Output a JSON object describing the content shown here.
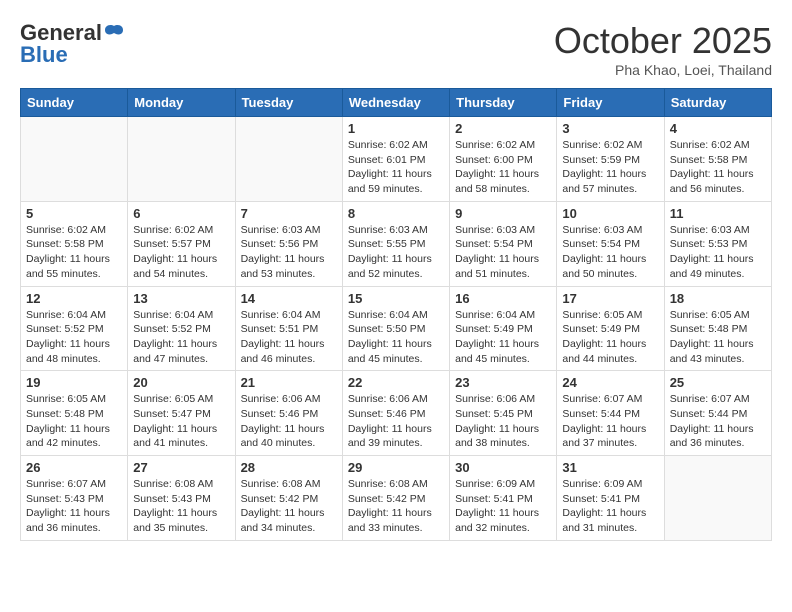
{
  "header": {
    "logo_general": "General",
    "logo_blue": "Blue",
    "month_title": "October 2025",
    "subtitle": "Pha Khao, Loei, Thailand"
  },
  "days_of_week": [
    "Sunday",
    "Monday",
    "Tuesday",
    "Wednesday",
    "Thursday",
    "Friday",
    "Saturday"
  ],
  "weeks": [
    [
      {
        "day": "",
        "info": ""
      },
      {
        "day": "",
        "info": ""
      },
      {
        "day": "",
        "info": ""
      },
      {
        "day": "1",
        "info": "Sunrise: 6:02 AM\nSunset: 6:01 PM\nDaylight: 11 hours\nand 59 minutes."
      },
      {
        "day": "2",
        "info": "Sunrise: 6:02 AM\nSunset: 6:00 PM\nDaylight: 11 hours\nand 58 minutes."
      },
      {
        "day": "3",
        "info": "Sunrise: 6:02 AM\nSunset: 5:59 PM\nDaylight: 11 hours\nand 57 minutes."
      },
      {
        "day": "4",
        "info": "Sunrise: 6:02 AM\nSunset: 5:58 PM\nDaylight: 11 hours\nand 56 minutes."
      }
    ],
    [
      {
        "day": "5",
        "info": "Sunrise: 6:02 AM\nSunset: 5:58 PM\nDaylight: 11 hours\nand 55 minutes."
      },
      {
        "day": "6",
        "info": "Sunrise: 6:02 AM\nSunset: 5:57 PM\nDaylight: 11 hours\nand 54 minutes."
      },
      {
        "day": "7",
        "info": "Sunrise: 6:03 AM\nSunset: 5:56 PM\nDaylight: 11 hours\nand 53 minutes."
      },
      {
        "day": "8",
        "info": "Sunrise: 6:03 AM\nSunset: 5:55 PM\nDaylight: 11 hours\nand 52 minutes."
      },
      {
        "day": "9",
        "info": "Sunrise: 6:03 AM\nSunset: 5:54 PM\nDaylight: 11 hours\nand 51 minutes."
      },
      {
        "day": "10",
        "info": "Sunrise: 6:03 AM\nSunset: 5:54 PM\nDaylight: 11 hours\nand 50 minutes."
      },
      {
        "day": "11",
        "info": "Sunrise: 6:03 AM\nSunset: 5:53 PM\nDaylight: 11 hours\nand 49 minutes."
      }
    ],
    [
      {
        "day": "12",
        "info": "Sunrise: 6:04 AM\nSunset: 5:52 PM\nDaylight: 11 hours\nand 48 minutes."
      },
      {
        "day": "13",
        "info": "Sunrise: 6:04 AM\nSunset: 5:52 PM\nDaylight: 11 hours\nand 47 minutes."
      },
      {
        "day": "14",
        "info": "Sunrise: 6:04 AM\nSunset: 5:51 PM\nDaylight: 11 hours\nand 46 minutes."
      },
      {
        "day": "15",
        "info": "Sunrise: 6:04 AM\nSunset: 5:50 PM\nDaylight: 11 hours\nand 45 minutes."
      },
      {
        "day": "16",
        "info": "Sunrise: 6:04 AM\nSunset: 5:49 PM\nDaylight: 11 hours\nand 45 minutes."
      },
      {
        "day": "17",
        "info": "Sunrise: 6:05 AM\nSunset: 5:49 PM\nDaylight: 11 hours\nand 44 minutes."
      },
      {
        "day": "18",
        "info": "Sunrise: 6:05 AM\nSunset: 5:48 PM\nDaylight: 11 hours\nand 43 minutes."
      }
    ],
    [
      {
        "day": "19",
        "info": "Sunrise: 6:05 AM\nSunset: 5:48 PM\nDaylight: 11 hours\nand 42 minutes."
      },
      {
        "day": "20",
        "info": "Sunrise: 6:05 AM\nSunset: 5:47 PM\nDaylight: 11 hours\nand 41 minutes."
      },
      {
        "day": "21",
        "info": "Sunrise: 6:06 AM\nSunset: 5:46 PM\nDaylight: 11 hours\nand 40 minutes."
      },
      {
        "day": "22",
        "info": "Sunrise: 6:06 AM\nSunset: 5:46 PM\nDaylight: 11 hours\nand 39 minutes."
      },
      {
        "day": "23",
        "info": "Sunrise: 6:06 AM\nSunset: 5:45 PM\nDaylight: 11 hours\nand 38 minutes."
      },
      {
        "day": "24",
        "info": "Sunrise: 6:07 AM\nSunset: 5:44 PM\nDaylight: 11 hours\nand 37 minutes."
      },
      {
        "day": "25",
        "info": "Sunrise: 6:07 AM\nSunset: 5:44 PM\nDaylight: 11 hours\nand 36 minutes."
      }
    ],
    [
      {
        "day": "26",
        "info": "Sunrise: 6:07 AM\nSunset: 5:43 PM\nDaylight: 11 hours\nand 36 minutes."
      },
      {
        "day": "27",
        "info": "Sunrise: 6:08 AM\nSunset: 5:43 PM\nDaylight: 11 hours\nand 35 minutes."
      },
      {
        "day": "28",
        "info": "Sunrise: 6:08 AM\nSunset: 5:42 PM\nDaylight: 11 hours\nand 34 minutes."
      },
      {
        "day": "29",
        "info": "Sunrise: 6:08 AM\nSunset: 5:42 PM\nDaylight: 11 hours\nand 33 minutes."
      },
      {
        "day": "30",
        "info": "Sunrise: 6:09 AM\nSunset: 5:41 PM\nDaylight: 11 hours\nand 32 minutes."
      },
      {
        "day": "31",
        "info": "Sunrise: 6:09 AM\nSunset: 5:41 PM\nDaylight: 11 hours\nand 31 minutes."
      },
      {
        "day": "",
        "info": ""
      }
    ]
  ]
}
